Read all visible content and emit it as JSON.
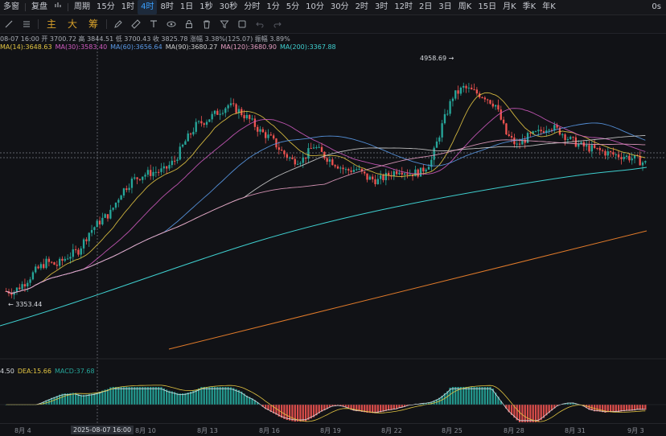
{
  "topbar": {
    "items": [
      "多窗",
      "复盘",
      "",
      "周期",
      "15分",
      "1时",
      "4时",
      "8时",
      "1日",
      "1秒",
      "30秒",
      "分时",
      "1分",
      "5分",
      "10分",
      "30分",
      "2时",
      "3时",
      "12时",
      "2日",
      "3日",
      "周K",
      "15日",
      "月K",
      "季K",
      "年K"
    ],
    "active_index": 6,
    "right_label": "0s"
  },
  "toolbar": {
    "tabs": [
      "主",
      "大",
      "筹"
    ],
    "tools": [
      "line-tool-icon",
      "pencil-icon",
      "ruler-icon",
      "text-icon",
      "eye-icon",
      "lock-icon",
      "trash-icon",
      "funnel-icon",
      "copy-icon",
      "undo-icon",
      "redo-icon"
    ]
  },
  "ohlc_line": "08-07 16:00 开 3700.72 高 3844.51 低 3700.43 收 3825.78 涨幅 3.38%(125.07) 振幅 3.89%",
  "ma_labels": [
    {
      "text": "MA(14):3648.63",
      "color": "#e3c542"
    },
    {
      "text": "MA(30):3583.40",
      "color": "#d05bc0"
    },
    {
      "text": "MA(60):3656.64",
      "color": "#5a9ae8"
    },
    {
      "text": "MA(90):3680.27",
      "color": "#cfcfcf"
    },
    {
      "text": "MA(120):3680.90",
      "color": "#e59dc1"
    },
    {
      "text": "MA(200):3367.88",
      "color": "#3fd0d0"
    }
  ],
  "macd_labels": [
    {
      "text": "4.50",
      "color": "#d8dbe0"
    },
    {
      "text": "DEA:15.66",
      "color": "#e3c542"
    },
    {
      "text": "MACD:37.68",
      "color": "#26a69a"
    }
  ],
  "annotations": {
    "high": "4958.69",
    "low": "3353.44"
  },
  "x_axis": {
    "labels": [
      "8月 4",
      "8月 10",
      "8月 13",
      "8月 16",
      "8月 19",
      "8月 22",
      "8月 25",
      "8月 28",
      "8月 31",
      "9月 3"
    ],
    "crosshair_label": "2025-08-07 16:00"
  },
  "colors": {
    "up": "#26a69a",
    "down": "#ef5350",
    "background": "#111216",
    "active": "#3aa0ff"
  },
  "chart_data": {
    "type": "candlestick",
    "x_start": "8月 3",
    "high": 4958.69,
    "low": 3353.44,
    "close": [
      3420,
      3480,
      3560,
      3620,
      3600,
      3660,
      3700,
      3825,
      3900,
      3960,
      4100,
      4180,
      4220,
      4240,
      4250,
      4320,
      4450,
      4560,
      4600,
      4650,
      4700,
      4660,
      4600,
      4520,
      4470,
      4380,
      4320,
      4330,
      4420,
      4350,
      4300,
      4250,
      4260,
      4200,
      4180,
      4220,
      4260,
      4230,
      4240,
      4320,
      4560,
      4760,
      4820,
      4790,
      4760,
      4700,
      4500,
      4420,
      4480,
      4510,
      4560,
      4520,
      4460,
      4420,
      4400,
      4380,
      4360,
      4350,
      4330,
      4300
    ]
  }
}
